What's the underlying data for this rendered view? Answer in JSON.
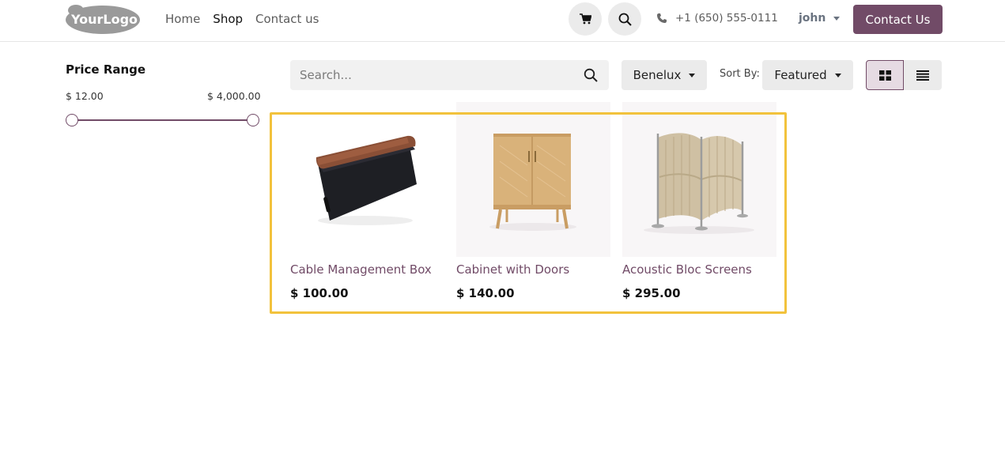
{
  "header": {
    "logo_text": "YourLogo",
    "nav": [
      {
        "label": "Home",
        "active": false
      },
      {
        "label": "Shop",
        "active": true
      },
      {
        "label": "Contact us",
        "active": false
      }
    ],
    "phone": "+1 (650) 555-0111",
    "user": "john",
    "contact_button": "Contact Us",
    "icons": {
      "cart": "cart-icon",
      "search": "search-icon",
      "phone": "phone-icon"
    }
  },
  "sidebar": {
    "price_title": "Price Range",
    "price_min": "$ 12.00",
    "price_max": "$ 4,000.00",
    "slider_min_fraction": 0,
    "slider_max_fraction": 1
  },
  "toolbar": {
    "search_placeholder": "Search...",
    "pricelist": "Benelux",
    "sort_label": "Sort By:",
    "sort_value": "Featured",
    "view_modes": [
      "grid",
      "list"
    ],
    "active_view": "grid"
  },
  "products": [
    {
      "name": "Cable Management Box",
      "price": "$ 100.00"
    },
    {
      "name": "Cabinet with Doors",
      "price": "$ 140.00"
    },
    {
      "name": "Acoustic Bloc Screens",
      "price": "$ 295.00"
    }
  ],
  "colors": {
    "brand": "#714B67",
    "highlight": "#f2c23c"
  }
}
